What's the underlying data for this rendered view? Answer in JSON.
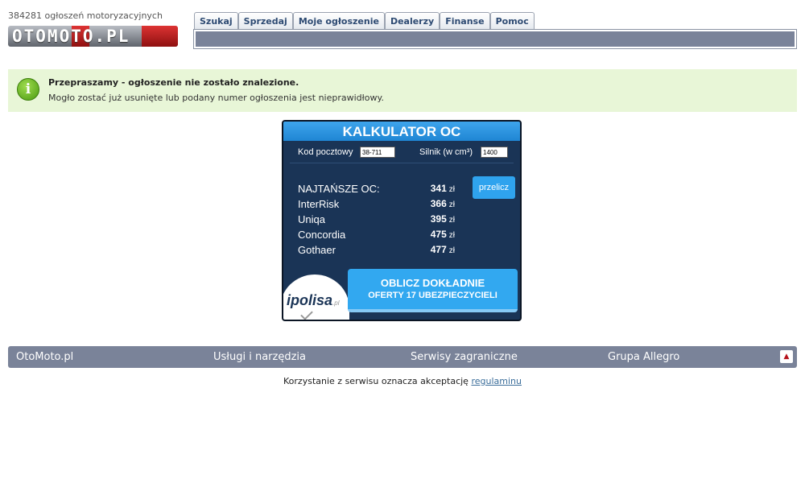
{
  "header": {
    "listing_count": "384281 ogłoszeń motoryzacyjnych",
    "logo_text": "OTOMOTO.PL"
  },
  "nav": {
    "tabs": [
      "Szukaj",
      "Sprzedaj",
      "Moje ogłoszenie",
      "Dealerzy",
      "Finanse",
      "Pomoc"
    ]
  },
  "info": {
    "icon": "info-icon",
    "title": "Przepraszamy - ogłoszenie nie zostało znalezione.",
    "text": "Mogło zostać już usunięte lub podany numer ogłoszenia jest nieprawidłowy."
  },
  "calculator": {
    "title": "KALKULATOR OC",
    "postal_label": "Kod pocztowy",
    "postal_value": "38-711",
    "engine_label": "Silnik (w cm³)",
    "engine_value": "1400",
    "recalc_label": "przelicz",
    "currency": "zł",
    "offers": [
      {
        "name": "NAJTAŃSZE OC:",
        "price": "341"
      },
      {
        "name": "InterRisk",
        "price": "366"
      },
      {
        "name": "Uniqa",
        "price": "395"
      },
      {
        "name": "Concordia",
        "price": "475"
      },
      {
        "name": "Gothaer",
        "price": "477"
      }
    ],
    "cta_line1": "OBLICZ DOKŁADNIE",
    "cta_line2": "OFERTY 17 UBEZPIECZYCIELI",
    "brand": "ipolisa",
    "brand_suffix": ".pl"
  },
  "footer": {
    "links": [
      "OtoMoto.pl",
      "Usługi i narzędzia",
      "Serwisy zagraniczne",
      "Grupa Allegro"
    ],
    "top_icon": "arrow-up-icon",
    "terms_text": "Korzystanie z serwisu oznacza akceptację",
    "terms_link": "regulaminu"
  }
}
